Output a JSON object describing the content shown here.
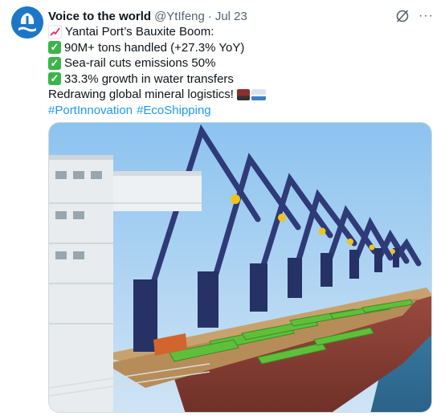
{
  "tweet": {
    "author_name": "Voice to the world",
    "handle": "@YtIfeng",
    "separator": "·",
    "time": "Jul 23",
    "more_label": "···",
    "lines": [
      "Yantai Port’s Bauxite Boom:",
      "90M+ tons handled (+27.3% YoY)",
      "Sea-rail cuts emissions 50%",
      "33.3% growth in water transfers",
      "Redrawing global mineral logistics!"
    ],
    "hashtags": [
      "#PortInnovation",
      "#EcoShipping"
    ]
  },
  "icons": {
    "avatar": "port-logo-avatar",
    "chart": "chart-increasing-emoji",
    "check": "check-mark-button-emoji",
    "train": "train-emoji",
    "ship": "ship-emoji",
    "grok": "grok-icon",
    "more": "more-icon"
  },
  "colors": {
    "link": "#1d9bf0",
    "secondary_text": "#536471",
    "check_green": "#3bb54a",
    "avatar_blue": "#1d77c8"
  }
}
